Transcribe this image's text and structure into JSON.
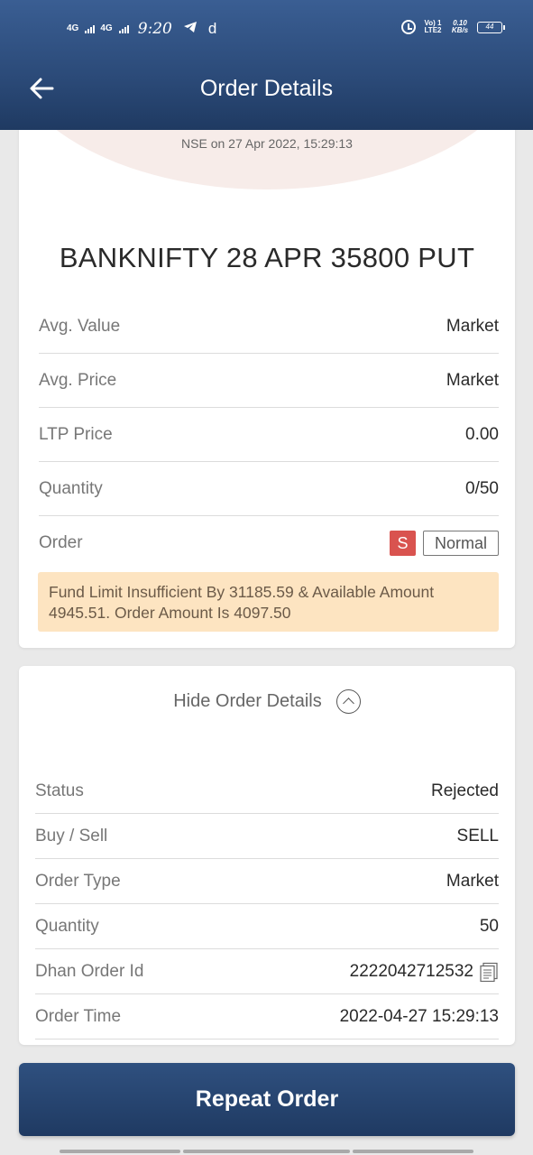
{
  "status_bar": {
    "network1": "4G",
    "network2": "4G",
    "time": "9:20",
    "app_icon_letter": "d",
    "volte": "Vo) 1 LTE2",
    "speed": "0.10 KB/s",
    "battery": "44"
  },
  "header": {
    "title": "Order Details",
    "back_icon": "arrow-left-icon"
  },
  "summary": {
    "exchange_time": "NSE on 27 Apr 2022, 15:29:13",
    "instrument": "BANKNIFTY 28 APR 35800 PUT",
    "rows": [
      {
        "label": "Avg. Value",
        "value": "Market"
      },
      {
        "label": "Avg. Price",
        "value": "Market"
      },
      {
        "label": "LTP Price",
        "value": "0.00"
      },
      {
        "label": "Quantity",
        "value": "0/50"
      }
    ],
    "order_label": "Order",
    "order_side_tag": "S",
    "order_type_tag": "Normal",
    "warning": "Fund Limit Insufficient By 31185.59 & Available Amount 4945.51. Order Amount Is 4097.50"
  },
  "details": {
    "toggle_label": "Hide Order Details",
    "rows": [
      {
        "label": "Status",
        "value": "Rejected"
      },
      {
        "label": "Buy / Sell",
        "value": "SELL"
      },
      {
        "label": "Order Type",
        "value": "Market"
      },
      {
        "label": "Quantity",
        "value": "50"
      },
      {
        "label": "Dhan Order Id",
        "value": "2222042712532"
      },
      {
        "label": "Order Time",
        "value": "2022-04-27 15:29:13"
      }
    ]
  },
  "actions": {
    "repeat_label": "Repeat Order"
  },
  "colors": {
    "header": "#2b4a78",
    "sell_tag": "#d9534f",
    "warning_bg": "#fde4c1"
  }
}
